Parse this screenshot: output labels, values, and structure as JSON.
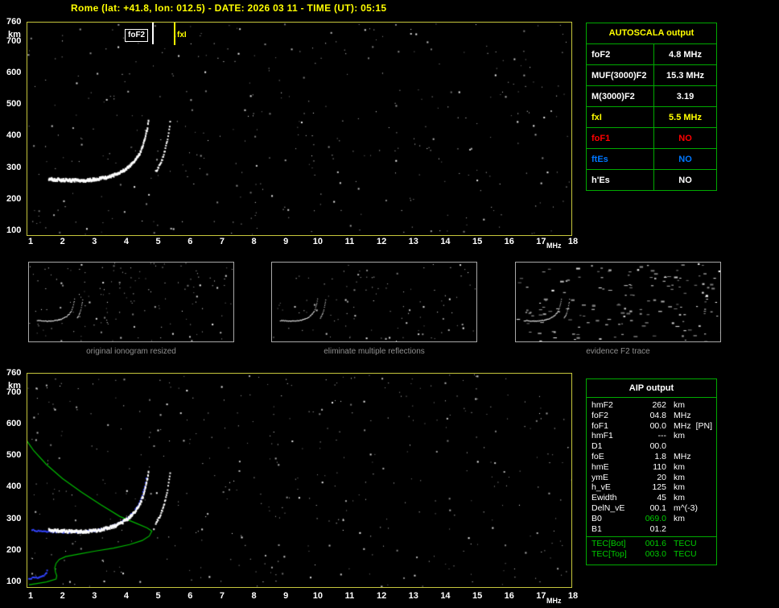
{
  "header": {
    "title": "Rome (lat: +41.8, lon: 012.5) - DATE: 2026 03 11 - TIME (UT): 05:15"
  },
  "autoscala": {
    "title": "AUTOSCALA output",
    "rows": [
      {
        "label": "foF2",
        "value": "4.8 MHz",
        "color": "#ffffff"
      },
      {
        "label": "MUF(3000)F2",
        "value": "15.3 MHz",
        "color": "#ffffff"
      },
      {
        "label": "M(3000)F2",
        "value": "3.19",
        "color": "#ffffff"
      },
      {
        "label": "fxI",
        "value": "5.5 MHz",
        "color": "#ffff00"
      },
      {
        "label": "foF1",
        "value": "NO",
        "color": "#ff0000"
      },
      {
        "label": "ftEs",
        "value": "NO",
        "color": "#0077ff"
      },
      {
        "label": "h'Es",
        "value": "NO",
        "color": "#ffffff"
      }
    ]
  },
  "aip": {
    "title": "AIP output",
    "divider_before_index": 13,
    "rows": [
      {
        "label": "hmF2",
        "value": "262",
        "unit": "km"
      },
      {
        "label": "foF2",
        "value": "04.8",
        "unit": "MHz"
      },
      {
        "label": "foF1",
        "value": "00.0",
        "unit": "MHz",
        "note": "[PN]"
      },
      {
        "label": "hmF1",
        "value": "---",
        "unit": "km"
      },
      {
        "label": "D1",
        "value": "00.0",
        "unit": ""
      },
      {
        "label": "foE",
        "value": "1.8",
        "unit": "MHz"
      },
      {
        "label": "hmE",
        "value": "110",
        "unit": "km"
      },
      {
        "label": "ymE",
        "value": "20",
        "unit": "km"
      },
      {
        "label": "h_vE",
        "value": "125",
        "unit": "km"
      },
      {
        "label": "Ewidth",
        "value": "45",
        "unit": "km"
      },
      {
        "label": "DelN_vE",
        "value": "00.1",
        "unit": "m^(-3)"
      },
      {
        "label": "B0",
        "value": "069.0",
        "unit": "km",
        "value_color": "#00cc00"
      },
      {
        "label": "B1",
        "value": "01.2",
        "unit": ""
      },
      {
        "label": "TEC[Bot]",
        "value": "001.6",
        "unit": "TECU",
        "color": "#00cc00"
      },
      {
        "label": "TEC[Top]",
        "value": "003.0",
        "unit": "TECU",
        "color": "#00cc00"
      }
    ]
  },
  "thumbnails": {
    "panels": [
      {
        "caption": "original ionogram resized",
        "noise": {
          "count": 150,
          "seed": 5,
          "style": "dots"
        }
      },
      {
        "caption": "eliminate multiple reflections",
        "noise": {
          "count": 105,
          "seed": 9,
          "style": "dots"
        }
      },
      {
        "caption": "evidence F2 trace",
        "noise": {
          "count": 160,
          "seed": 17,
          "style": "dashes"
        }
      }
    ]
  },
  "chart_data": [
    {
      "name": "scaled-ionogram",
      "type": "scatter",
      "x_ticks": [
        1,
        2,
        3,
        4,
        5,
        6,
        7,
        8,
        9,
        10,
        11,
        12,
        13,
        14,
        15,
        16,
        17,
        18
      ],
      "y_ticks": [
        760,
        700,
        600,
        500,
        400,
        300,
        200,
        100
      ],
      "x_unit": "MHz",
      "y_unit": "km",
      "xlim": [
        1,
        18
      ],
      "ylim": [
        87,
        760
      ],
      "markers": [
        {
          "label": "foF2",
          "freq": 4.8,
          "color": "#ffffff"
        },
        {
          "label": "fxI",
          "freq": 5.5,
          "color": "#ffff00"
        }
      ],
      "traces": [
        {
          "name": "F2-trace-ordinary",
          "color": "#ffffff",
          "size": [
            2,
            3
          ],
          "points": [
            [
              1.55,
              268
            ],
            [
              1.9,
              266
            ],
            [
              2.3,
              264
            ],
            [
              2.7,
              264
            ],
            [
              3.0,
              267
            ],
            [
              3.3,
              272
            ],
            [
              3.6,
              281
            ],
            [
              3.85,
              293
            ],
            [
              4.05,
              307
            ],
            [
              4.25,
              326
            ],
            [
              4.4,
              349
            ],
            [
              4.5,
              375
            ],
            [
              4.58,
              403
            ],
            [
              4.64,
              432
            ],
            [
              4.67,
              452
            ]
          ]
        },
        {
          "name": "F2-trace-extraordinary",
          "color": "#ffffff",
          "size": [
            2,
            2
          ],
          "points": [
            [
              4.9,
              290
            ],
            [
              5.02,
              310
            ],
            [
              5.12,
              335
            ],
            [
              5.2,
              362
            ],
            [
              5.27,
              395
            ],
            [
              5.32,
              425
            ],
            [
              5.35,
              448
            ]
          ]
        }
      ],
      "noise": {
        "count": 400,
        "seed": 11,
        "style": "dots"
      }
    },
    {
      "name": "ionogram-with-restored-profile",
      "type": "scatter",
      "x_ticks": [
        1,
        2,
        3,
        4,
        5,
        6,
        7,
        8,
        9,
        10,
        11,
        12,
        13,
        14,
        15,
        16,
        17,
        18
      ],
      "y_ticks": [
        760,
        700,
        600,
        500,
        400,
        300,
        200,
        100
      ],
      "x_unit": "MHz",
      "y_unit": "km",
      "xlim": [
        1,
        18
      ],
      "ylim": [
        87,
        760
      ],
      "traces_ref": 0,
      "profile": {
        "name": "electron-density-profile",
        "color": "#00bb00",
        "points": [
          [
            0.85,
            552
          ],
          [
            1.1,
            516
          ],
          [
            1.5,
            472
          ],
          [
            2.0,
            428
          ],
          [
            2.6,
            385
          ],
          [
            3.2,
            345
          ],
          [
            3.8,
            308
          ],
          [
            4.3,
            287
          ],
          [
            4.65,
            272
          ],
          [
            4.8,
            262
          ],
          [
            4.72,
            246
          ],
          [
            4.5,
            232
          ],
          [
            4.1,
            219
          ],
          [
            3.6,
            208
          ],
          [
            3.0,
            198
          ],
          [
            2.5,
            189
          ],
          [
            2.1,
            181
          ],
          [
            1.9,
            172
          ],
          [
            1.8,
            160
          ],
          [
            1.76,
            146
          ],
          [
            1.78,
            132
          ],
          [
            1.82,
            120
          ],
          [
            1.8,
            110
          ],
          [
            1.5,
            101
          ],
          [
            1.2,
            96
          ],
          [
            0.95,
            92
          ]
        ]
      },
      "restored_trace": {
        "name": "restored-F-trace",
        "color": "#3344ff",
        "points": [
          [
            1.05,
            264
          ],
          [
            1.4,
            262
          ],
          [
            1.8,
            259
          ],
          [
            2.2,
            258
          ],
          [
            2.6,
            259
          ],
          [
            3.0,
            263
          ],
          [
            3.3,
            269
          ],
          [
            3.6,
            278
          ],
          [
            3.85,
            290
          ],
          [
            4.05,
            304
          ],
          [
            4.25,
            323
          ],
          [
            4.4,
            347
          ],
          [
            4.5,
            374
          ],
          [
            4.58,
            402
          ],
          [
            4.63,
            428
          ]
        ]
      },
      "restored_e_trace": {
        "name": "restored-E-trace",
        "color": "#3344ff",
        "points": [
          [
            0.95,
            112
          ],
          [
            1.1,
            113
          ],
          [
            1.25,
            116
          ],
          [
            1.38,
            120
          ],
          [
            1.48,
            127
          ],
          [
            1.52,
            136
          ]
        ]
      },
      "noise": {
        "count": 430,
        "seed": 23,
        "style": "dots"
      }
    }
  ]
}
